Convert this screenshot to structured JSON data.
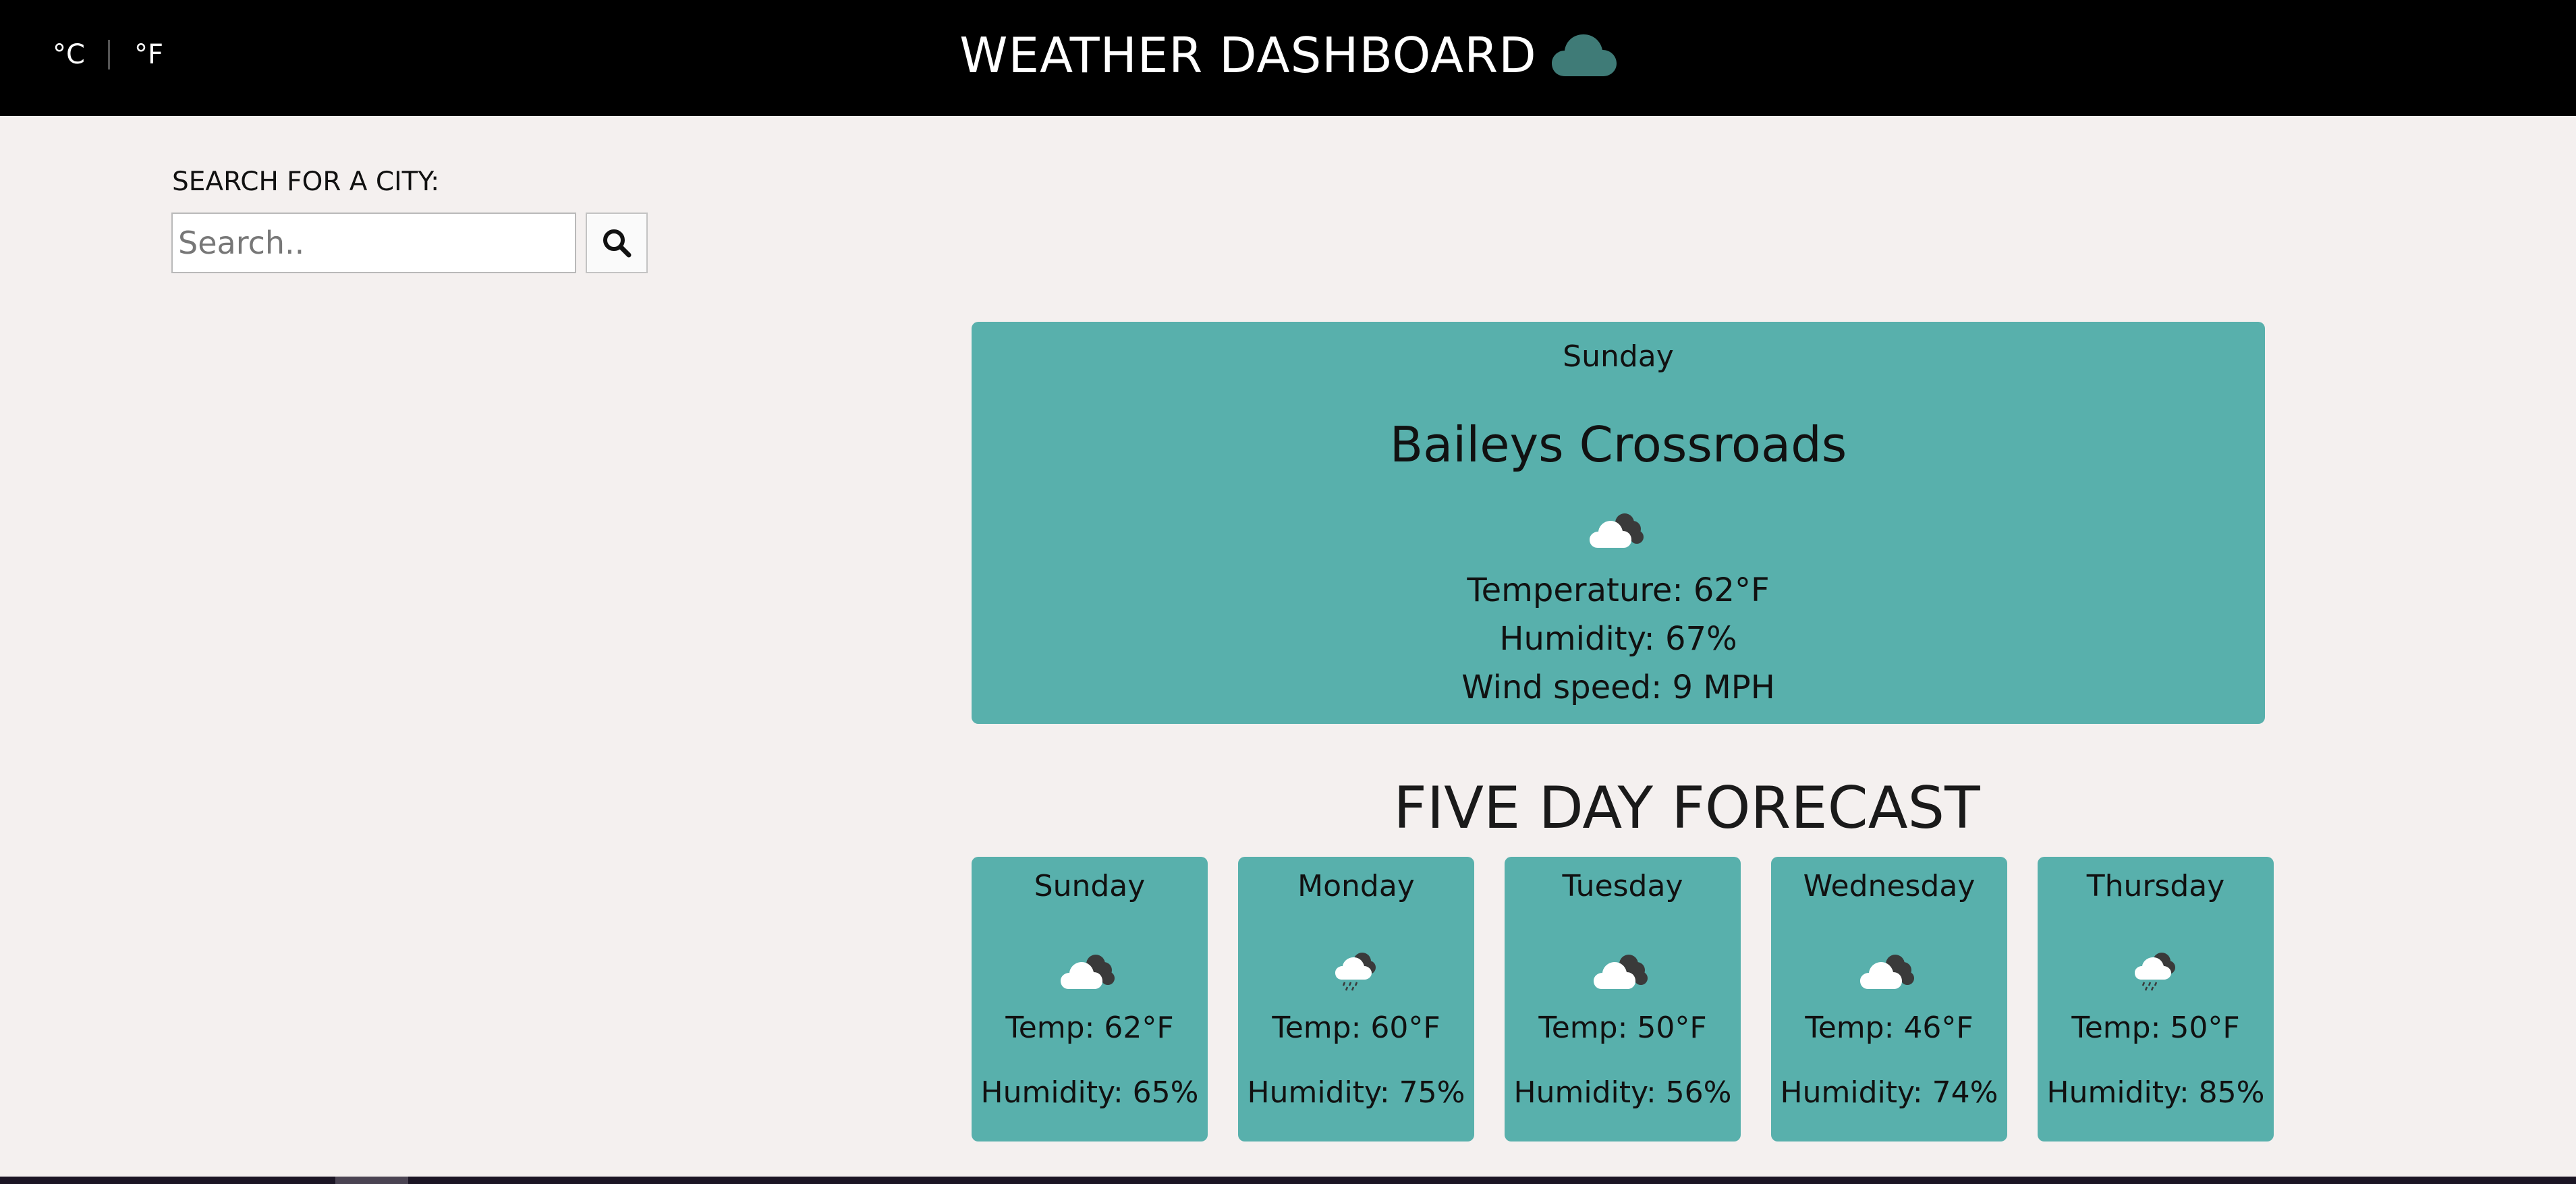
{
  "header": {
    "celsius_label": "°C",
    "fahrenheit_label": "°F",
    "title": "WEATHER DASHBOARD",
    "title_icon": "cloud-icon",
    "icon_color": "#3f7b77"
  },
  "search": {
    "label": "SEARCH FOR A CITY:",
    "value": "",
    "placeholder": "Search..",
    "button_icon": "search-icon"
  },
  "current": {
    "day": "Sunday",
    "city": "Baileys Crossroads",
    "icon": "partly-cloudy-icon",
    "temperature": "Temperature: 62°F",
    "humidity": "Humidity: 67%",
    "wind": "Wind speed: 9 MPH"
  },
  "forecast": {
    "title": "FIVE DAY FORECAST",
    "days": [
      {
        "day": "Sunday",
        "icon": "partly-cloudy-icon",
        "temp": "Temp: 62°F",
        "humidity": "Humidity: 65%"
      },
      {
        "day": "Monday",
        "icon": "rain-cloud-icon",
        "temp": "Temp: 60°F",
        "humidity": "Humidity: 75%"
      },
      {
        "day": "Tuesday",
        "icon": "partly-cloudy-icon",
        "temp": "Temp: 50°F",
        "humidity": "Humidity: 56%"
      },
      {
        "day": "Wednesday",
        "icon": "partly-cloudy-icon",
        "temp": "Temp: 46°F",
        "humidity": "Humidity: 74%"
      },
      {
        "day": "Thursday",
        "icon": "rain-cloud-icon",
        "temp": "Temp: 50°F",
        "humidity": "Humidity: 85%"
      }
    ]
  },
  "colors": {
    "header_bg": "#000000",
    "page_bg": "#f4f0ef",
    "card_bg": "#58b0ac"
  }
}
